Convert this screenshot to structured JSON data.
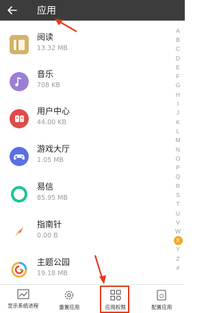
{
  "header": {
    "title": "应用"
  },
  "apps": [
    {
      "name": "阅读",
      "size": "13.32 MB",
      "icon": "book-icon",
      "color": "#d4b26a"
    },
    {
      "name": "音乐",
      "size": "708 KB",
      "icon": "music-note-icon",
      "color": "#9b7fd4"
    },
    {
      "name": "用户中心",
      "size": "44.00 KB",
      "icon": "user-center-icon",
      "color": "#e04a4a"
    },
    {
      "name": "游戏大厅",
      "size": "1.05 MB",
      "icon": "gamepad-icon",
      "color": "#5b6fe6"
    },
    {
      "name": "易信",
      "size": "85.95 MB",
      "icon": "yixin-chat-icon",
      "color": "#1cc39a"
    },
    {
      "name": "指南针",
      "size": "0.00 B",
      "icon": "compass-icon",
      "color": "#f08a4b"
    },
    {
      "name": "主题公园",
      "size": "19.18 MB",
      "icon": "theme-park-icon",
      "color": "#f3b33d"
    }
  ],
  "index_letters": [
    "A",
    "B",
    "C",
    "D",
    "E",
    "F",
    "G",
    "H",
    "I",
    "J",
    "K",
    "L",
    "M",
    "N",
    "O",
    "P",
    "Q",
    "R",
    "S",
    "T",
    "U",
    "V",
    "W",
    "X",
    "Y",
    "Z",
    "#"
  ],
  "index_active": "X",
  "bottom_tabs": [
    {
      "label": "显示系统进程",
      "icon": "chart-icon"
    },
    {
      "label": "重置应用",
      "icon": "gear-icon"
    },
    {
      "label": "应用权限",
      "icon": "grid-apps-icon"
    },
    {
      "label": "配置应用",
      "icon": "settings-file-icon"
    }
  ],
  "colors": {
    "appbar": "#3c3c3c",
    "annotation_red": "#e53a1b",
    "index_active": "#f5a623"
  }
}
